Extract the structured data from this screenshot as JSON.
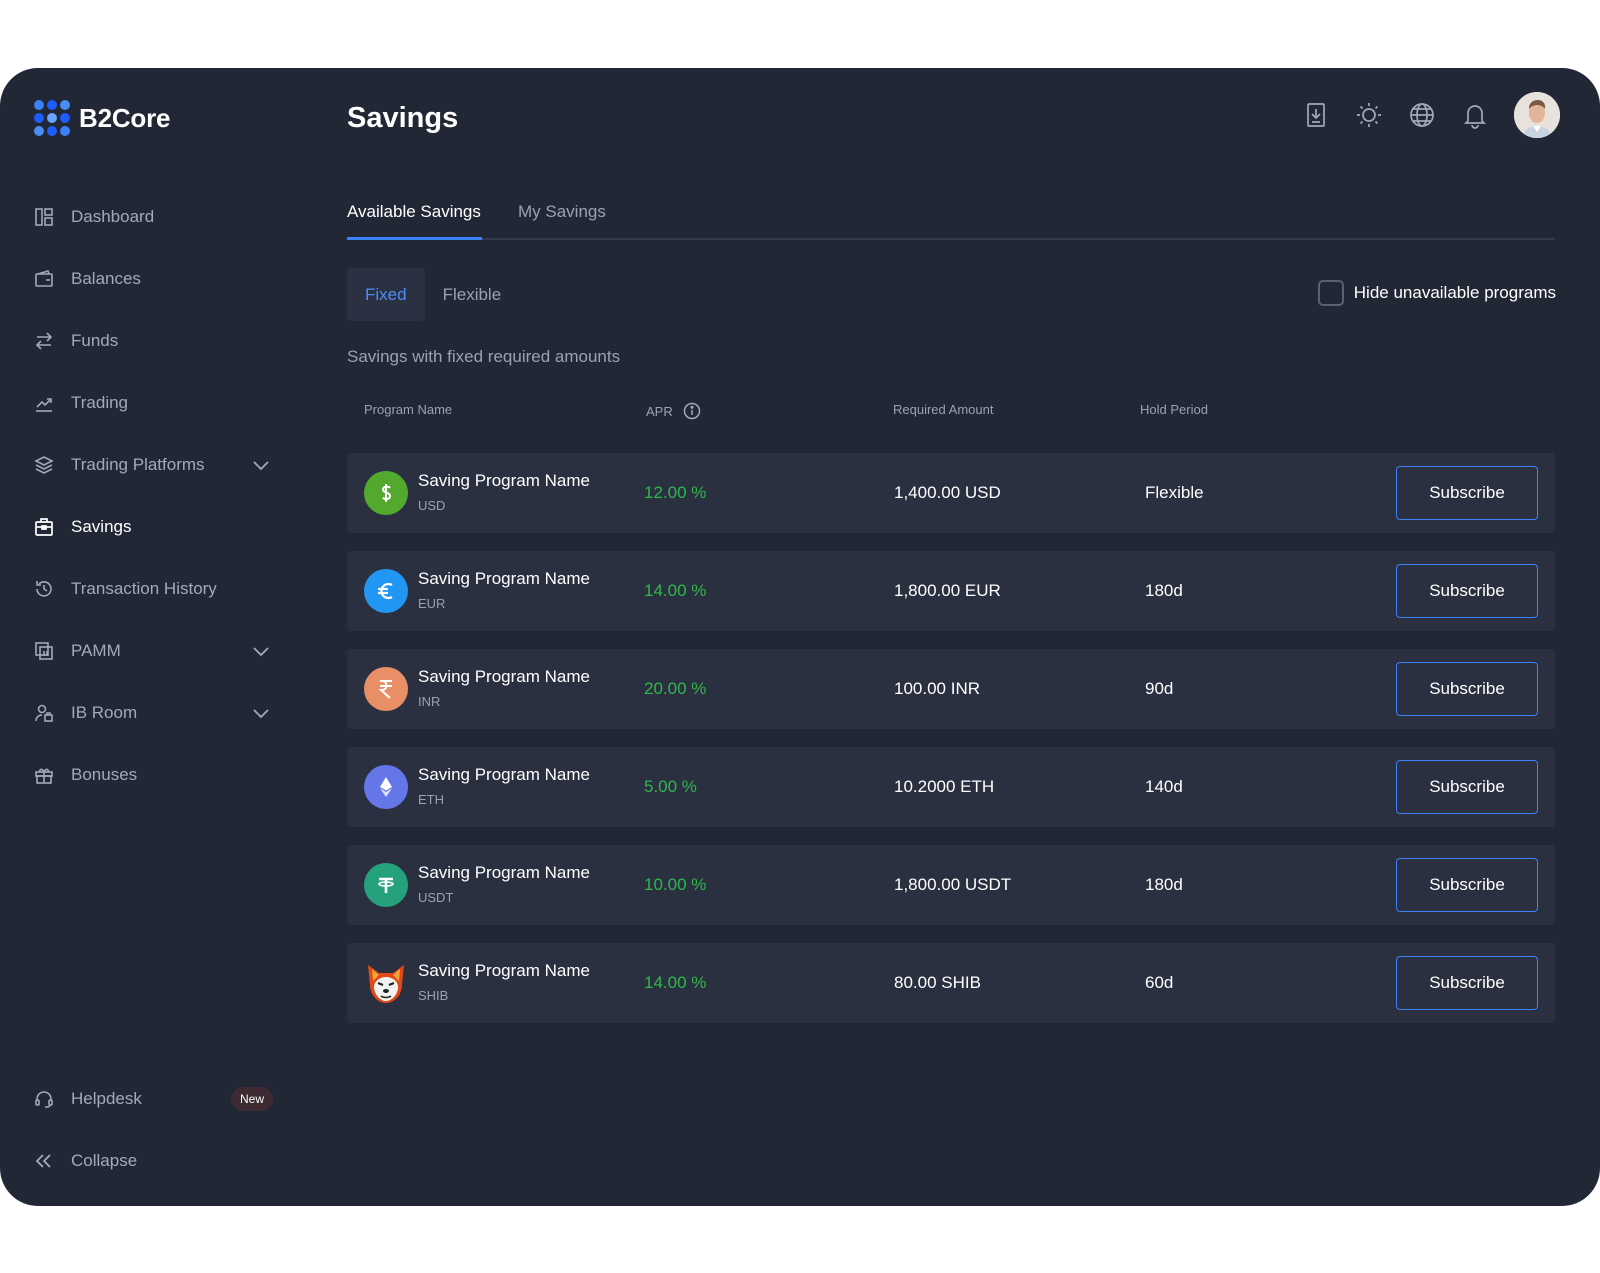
{
  "brand": {
    "name": "B2Core"
  },
  "header": {
    "title": "Savings"
  },
  "sidebar": {
    "items": [
      {
        "label": "Dashboard"
      },
      {
        "label": "Balances"
      },
      {
        "label": "Funds"
      },
      {
        "label": "Trading"
      },
      {
        "label": "Trading Platforms"
      },
      {
        "label": "Savings"
      },
      {
        "label": "Transaction History"
      },
      {
        "label": "PAMM"
      },
      {
        "label": "IB Room"
      },
      {
        "label": "Bonuses"
      }
    ],
    "helpdesk": {
      "label": "Helpdesk",
      "badge": "New"
    },
    "collapse": {
      "label": "Collapse"
    }
  },
  "tabs": [
    {
      "label": "Available Savings"
    },
    {
      "label": "My Savings"
    }
  ],
  "segments": [
    {
      "label": "Fixed"
    },
    {
      "label": "Flexible"
    }
  ],
  "filter": {
    "hide_unavailable": "Hide unavailable programs"
  },
  "section": {
    "description": "Savings with fixed required amounts"
  },
  "table": {
    "columns": {
      "program": "Program Name",
      "apr": "APR",
      "amount": "Required Amount",
      "hold": "Hold Period"
    },
    "subscribe_label": "Subscribe",
    "rows": [
      {
        "name": "Saving Program Name",
        "currency": "USD",
        "apr": "12.00 %",
        "amount": "1,400.00 USD",
        "hold": "Flexible"
      },
      {
        "name": "Saving Program Name",
        "currency": "EUR",
        "apr": "14.00 %",
        "amount": "1,800.00 EUR",
        "hold": "180d"
      },
      {
        "name": "Saving Program Name",
        "currency": "INR",
        "apr": "20.00 %",
        "amount": "100.00 INR",
        "hold": "90d"
      },
      {
        "name": "Saving Program Name",
        "currency": "ETH",
        "apr": "5.00 %",
        "amount": "10.2000 ETH",
        "hold": "140d"
      },
      {
        "name": "Saving Program Name",
        "currency": "USDT",
        "apr": "10.00 %",
        "amount": "1,800.00 USDT",
        "hold": "180d"
      },
      {
        "name": "Saving Program Name",
        "currency": "SHIB",
        "apr": "14.00 %",
        "amount": "80.00 SHIB",
        "hold": "60d"
      }
    ]
  },
  "colors": {
    "background": "#222736",
    "row": "#2a3040",
    "accent": "#3b82f6",
    "apr_green": "#2fb84a",
    "muted_text": "#9aa1b1"
  },
  "icons": {
    "header": [
      "download-icon",
      "sun-icon",
      "globe-icon",
      "bell-icon",
      "avatar"
    ],
    "coins": [
      "dollar-coin-icon",
      "euro-coin-icon",
      "rupee-coin-icon",
      "ethereum-coin-icon",
      "tether-coin-icon",
      "shiba-coin-icon"
    ]
  }
}
